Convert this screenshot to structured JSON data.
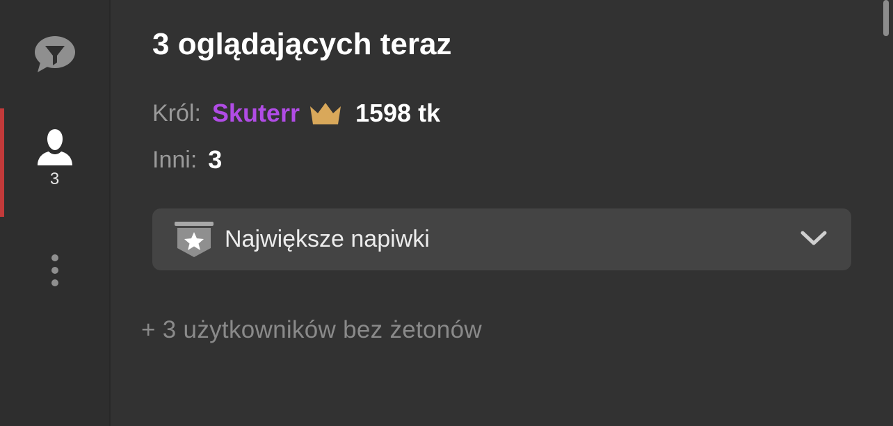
{
  "sidebar": {
    "items": [
      {
        "name": "chat",
        "icon": "chat-filter-icon"
      },
      {
        "name": "users",
        "icon": "user-icon",
        "count": "3",
        "active": true
      },
      {
        "name": "more",
        "icon": "more-vertical-icon"
      }
    ],
    "active_indicator_color": "#c23a3a"
  },
  "main": {
    "title": "3 oglądających teraz",
    "king": {
      "label": "Król:",
      "name": "Skuterr",
      "name_color": "#b14ce6",
      "crown_icon": "crown-icon",
      "crown_color": "#d9a85a",
      "tokens": "1598 tk"
    },
    "others": {
      "label": "Inni:",
      "value": "3"
    },
    "dropdown": {
      "icon": "star-badge-icon",
      "label": "Największe napiwki",
      "chevron_icon": "chevron-down-icon"
    },
    "no_tokens_text": "+ 3 użytkowników bez żetonów"
  }
}
